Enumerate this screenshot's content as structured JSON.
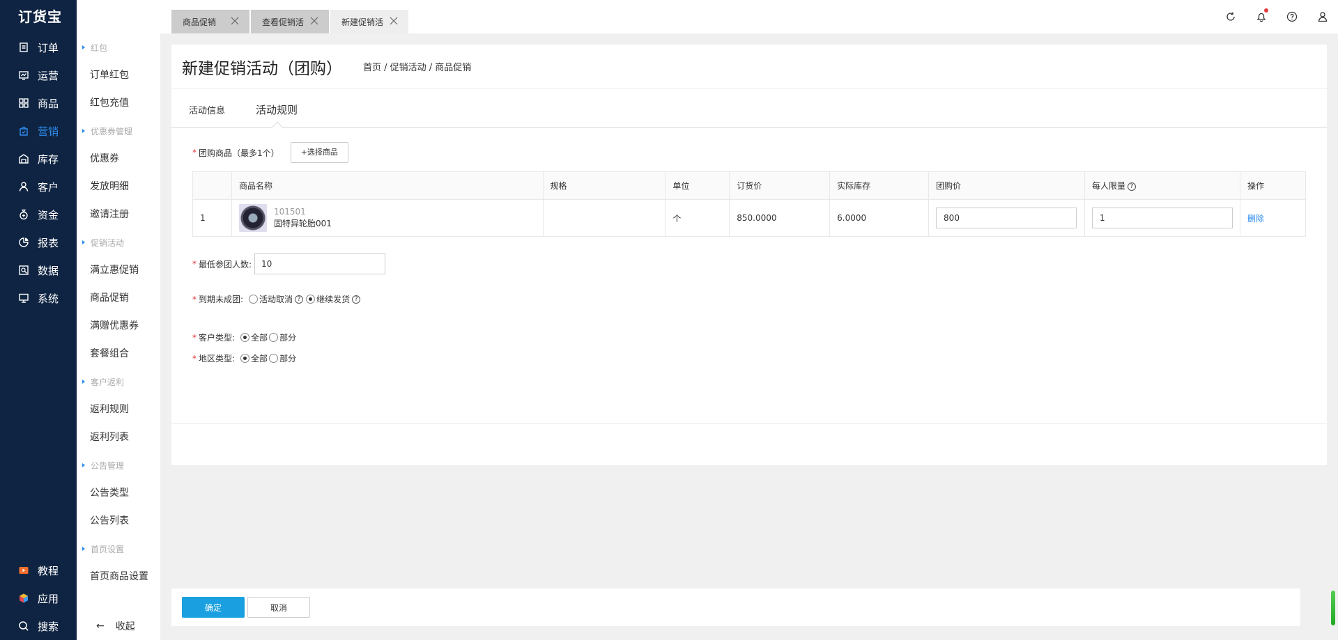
{
  "app": {
    "logo": "订货宝"
  },
  "leftnav": {
    "items": [
      {
        "label": "订单",
        "icon": "order-icon"
      },
      {
        "label": "运营",
        "icon": "operation-icon"
      },
      {
        "label": "商品",
        "icon": "goods-icon"
      },
      {
        "label": "营销",
        "icon": "marketing-icon",
        "active": true
      },
      {
        "label": "库存",
        "icon": "warehouse-icon"
      },
      {
        "label": "客户",
        "icon": "customer-icon"
      },
      {
        "label": "资金",
        "icon": "money-icon"
      },
      {
        "label": "报表",
        "icon": "report-icon"
      },
      {
        "label": "数据",
        "icon": "data-icon"
      },
      {
        "label": "系统",
        "icon": "system-icon"
      }
    ],
    "bottom": [
      {
        "label": "教程",
        "icon": "tutorial-icon"
      },
      {
        "label": "应用",
        "icon": "apps-icon"
      },
      {
        "label": "搜索",
        "icon": "search-icon"
      }
    ]
  },
  "subnav": {
    "groups": [
      {
        "title": "红包",
        "items": [
          "订单红包",
          "红包充值"
        ]
      },
      {
        "title": "优惠券管理",
        "items": [
          "优惠券",
          "发放明细",
          "邀请注册"
        ]
      },
      {
        "title": "促销活动",
        "items": [
          "满立惠促销",
          "商品促销",
          "满赠优惠券",
          "套餐组合"
        ]
      },
      {
        "title": "客户返利",
        "items": [
          "返利规则",
          "返利列表"
        ]
      },
      {
        "title": "公告管理",
        "items": [
          "公告类型",
          "公告列表"
        ]
      },
      {
        "title": "首页设置",
        "items": [
          "首页商品设置"
        ]
      }
    ],
    "collapse": "收起",
    "collapse_arrow": "←"
  },
  "tabs": [
    {
      "label": "商品促销"
    },
    {
      "label": "查看促销活"
    },
    {
      "label": "新建促销活",
      "active": true
    }
  ],
  "page": {
    "title": "新建促销活动（团购）",
    "breadcrumb": "首页 / 促销活动 / 商品促销",
    "tabs": {
      "info": "活动信息",
      "rules": "活动规则"
    }
  },
  "form": {
    "goods_label": "团购商品（最多1个）",
    "select_goods": "+选择商品",
    "table": {
      "headers": [
        "",
        "商品名称",
        "规格",
        "单位",
        "订货价",
        "实际库存",
        "团购价",
        "每人限量",
        "操作"
      ],
      "rows": [
        {
          "index": "1",
          "code": "101501",
          "name": "固特异轮胎001",
          "spec": "",
          "unit": "个",
          "price": "850.0000",
          "stock": "6.0000",
          "group_price": "800",
          "limit": "1",
          "action": "删除"
        }
      ]
    },
    "min_people_label": "最低参团人数:",
    "min_people": "10",
    "expire_label": "到期未成团:",
    "expire_options": [
      "活动取消",
      "继续发货"
    ],
    "expire_selected": 1,
    "customer_type_label": "客户类型:",
    "region_type_label": "地区类型:",
    "type_options": [
      "全部",
      "部分"
    ]
  },
  "actions": {
    "ok": "确定",
    "cancel": "取消"
  }
}
